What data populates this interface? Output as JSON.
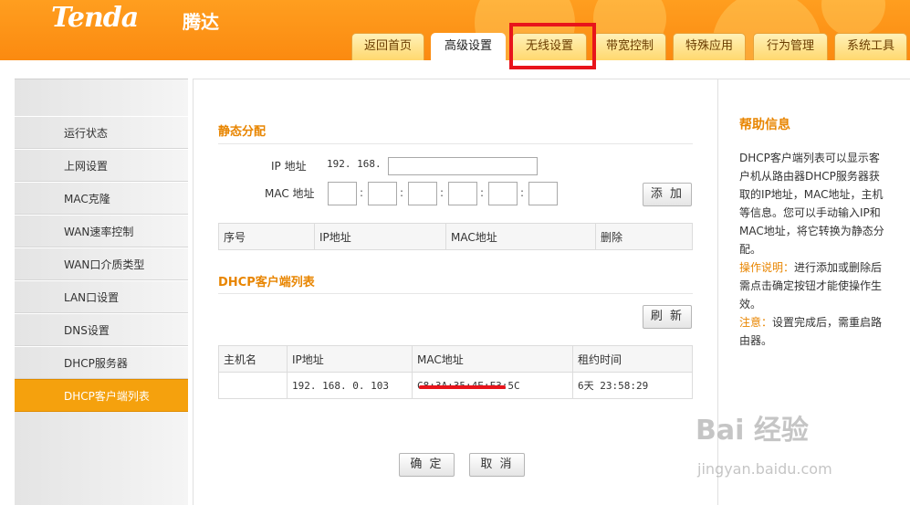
{
  "brand": {
    "logo": "Tenda",
    "logo_cn": "腾达"
  },
  "nav": {
    "tabs": [
      {
        "label": "返回首页"
      },
      {
        "label": "高级设置",
        "active": true
      },
      {
        "label": "无线设置"
      },
      {
        "label": "带宽控制"
      },
      {
        "label": "特殊应用"
      },
      {
        "label": "行为管理"
      },
      {
        "label": "系统工具"
      }
    ]
  },
  "sidebar": {
    "items": [
      {
        "label": "运行状态"
      },
      {
        "label": "上网设置"
      },
      {
        "label": "MAC克隆"
      },
      {
        "label": "WAN速率控制"
      },
      {
        "label": "WAN口介质类型"
      },
      {
        "label": "LAN口设置"
      },
      {
        "label": "DNS设置"
      },
      {
        "label": "DHCP服务器"
      },
      {
        "label": "DHCP客户端列表",
        "active": true
      }
    ]
  },
  "static": {
    "title": "静态分配",
    "ip_label": "IP 地址",
    "ip_prefix": "192. 168. 0.",
    "ip_value": "",
    "mac_label": "MAC 地址",
    "mac_values": [
      "",
      "",
      "",
      "",
      "",
      ""
    ],
    "add_button": "添 加",
    "table_headers": [
      "序号",
      "IP地址",
      "MAC地址",
      "删除"
    ]
  },
  "dhcp": {
    "title": "DHCP客户端列表",
    "refresh_button": "刷 新",
    "table_headers": [
      "主机名",
      "IP地址",
      "MAC地址",
      "租约时间"
    ],
    "rows": [
      {
        "host": "",
        "ip": "192. 168. 0. 103",
        "mac": "C8:3A:35:4E:F3:5C",
        "lease": "6天 23:58:29"
      }
    ]
  },
  "actions": {
    "ok": "确 定",
    "cancel": "取 消"
  },
  "help": {
    "title": "帮助信息",
    "body": "DHCP客户端列表可以显示客户机从路由器DHCP服务器获取的IP地址，MAC地址，主机等信息。您可以手动输入IP和MAC地址，将它转换为静态分配。",
    "op_label": "操作说明：",
    "op_text": "进行添加或删除后需点击确定按钮才能使操作生效。",
    "note_label": "注意：",
    "note_text": "设置完成后，需重启路由器。"
  },
  "watermark": {
    "line1": "Bai 经验",
    "line2": "jingyan.baidu.com"
  },
  "colors": {
    "accent": "#f5a10d",
    "highlight_box": "#e8141b",
    "section_title": "#e88500"
  }
}
